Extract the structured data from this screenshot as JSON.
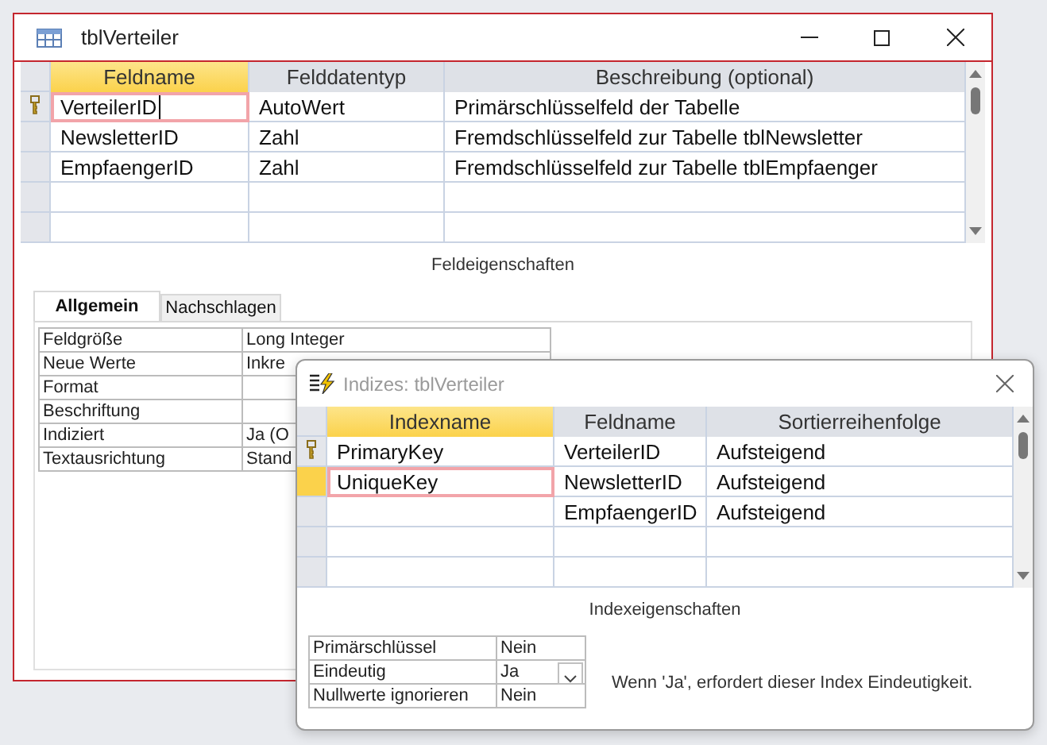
{
  "main_window": {
    "title": "tblVerteiler",
    "grid": {
      "columns": [
        {
          "label": "Feldname",
          "selected": true
        },
        {
          "label": "Felddatentyp",
          "selected": false
        },
        {
          "label": "Beschreibung (optional)",
          "selected": false
        }
      ],
      "rows": [
        {
          "cells": [
            "VerteilerID",
            "AutoWert",
            "Primärschlüsselfeld der Tabelle"
          ],
          "primary_key": true,
          "selected": true,
          "editing": true
        },
        {
          "cells": [
            "NewsletterID",
            "Zahl",
            "Fremdschlüsselfeld zur Tabelle tblNewsletter"
          ],
          "primary_key": false,
          "selected": false,
          "editing": false
        },
        {
          "cells": [
            "EmpfaengerID",
            "Zahl",
            "Fremdschlüsselfeld zur Tabelle tblEmpfaenger"
          ],
          "primary_key": false,
          "selected": false,
          "editing": false
        }
      ]
    },
    "properties_caption": "Feldeigenschaften",
    "tabs": [
      {
        "label": "Allgemein",
        "selected": true
      },
      {
        "label": "Nachschlagen",
        "selected": false
      }
    ],
    "properties": [
      {
        "label": "Feldgröße",
        "value": "Long Integer"
      },
      {
        "label": "Neue Werte",
        "value": "Inkre"
      },
      {
        "label": "Format"
      },
      {
        "label": "Beschriftung"
      },
      {
        "label": "Indiziert",
        "value": "Ja (O"
      },
      {
        "label": "Textausrichtung",
        "value": "Stand"
      }
    ]
  },
  "index_dialog": {
    "title": "Indizes: tblVerteiler",
    "grid": {
      "columns": [
        {
          "label": "Indexname",
          "selected": true
        },
        {
          "label": "Feldname",
          "selected": false
        },
        {
          "label": "Sortierreihenfolge",
          "selected": false
        }
      ],
      "rows": [
        {
          "cells": [
            "PrimaryKey",
            "VerteilerID",
            "Aufsteigend"
          ],
          "primary_key": true,
          "selected": false,
          "editing": false
        },
        {
          "cells": [
            "UniqueKey",
            "NewsletterID",
            "Aufsteigend"
          ],
          "primary_key": false,
          "selected": true,
          "editing": false
        },
        {
          "cells": [
            null,
            "EmpfaengerID",
            "Aufsteigend"
          ],
          "primary_key": false,
          "selected": false,
          "editing": false
        }
      ]
    },
    "properties_caption": "Indexeigenschaften",
    "properties": [
      {
        "label": "Primärschlüssel",
        "value": "Nein",
        "dropdown": false
      },
      {
        "label": "Eindeutig",
        "value": "Ja",
        "dropdown": true
      },
      {
        "label": "Nullwerte ignorieren",
        "value": "Nein",
        "dropdown": false
      }
    ],
    "help_text": "Wenn 'Ja', erfordert dieser Index Eindeutigkeit."
  }
}
